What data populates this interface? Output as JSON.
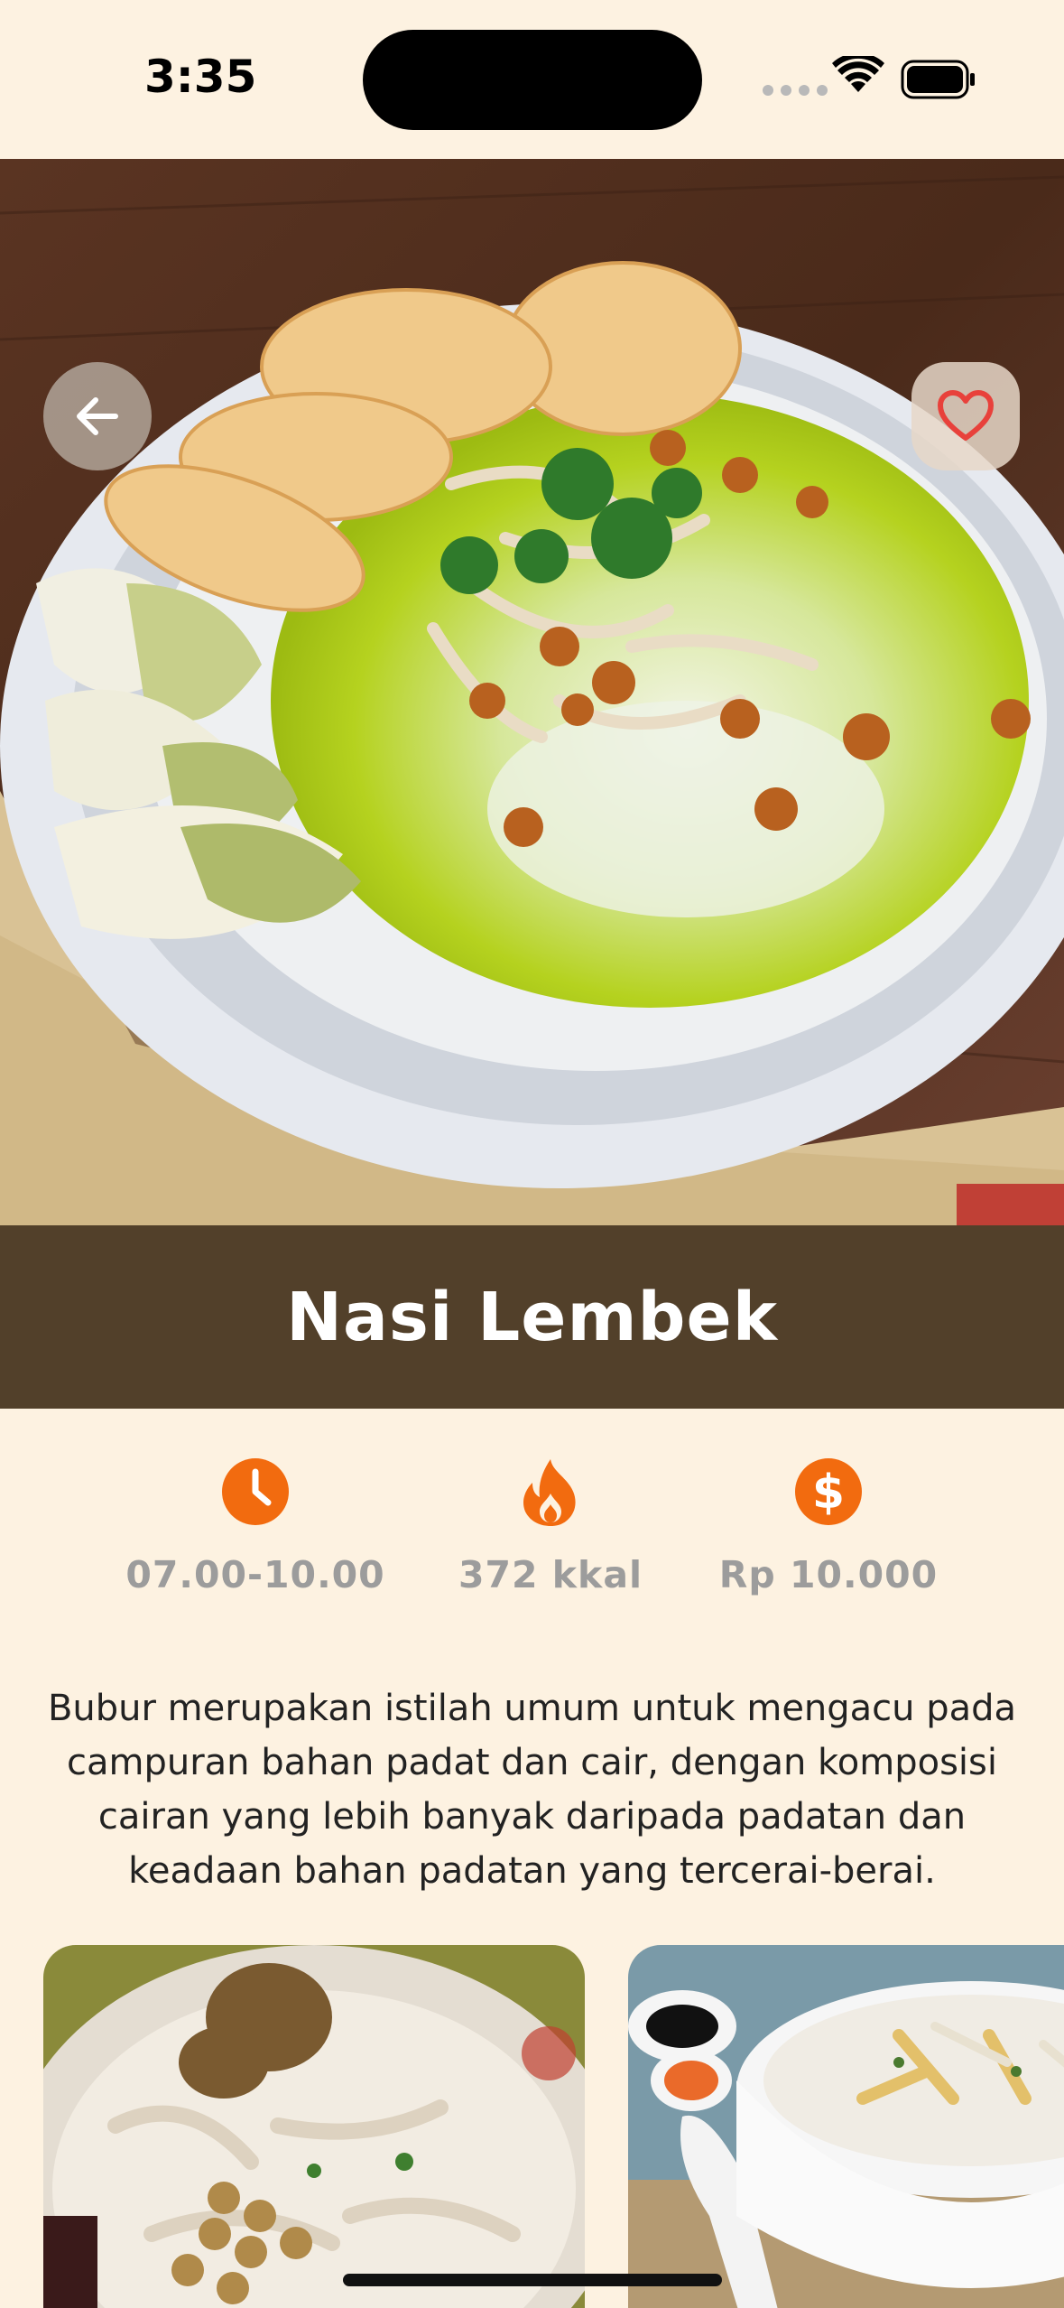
{
  "status_bar": {
    "time": "3:35"
  },
  "hero": {
    "image_description": "bowl of rice porridge with yellow curry sauce, crackers, chicken, fried soybeans and egg",
    "back_icon": "arrow-left-icon",
    "favorite_icon": "heart-outline-icon"
  },
  "dish": {
    "title": "Nasi Lembek"
  },
  "info": {
    "time": "07.00-10.00",
    "calories": "372 kkal",
    "price": "Rp 10.000",
    "icons": [
      "clock-icon",
      "flame-icon",
      "dollar-icon"
    ],
    "icon_color": "#F26B0F"
  },
  "description": "Bubur merupakan istilah umum untuk mengacu pada campuran bahan padat dan cair, dengan komposisi cairan yang lebih banyak daripada padatan dan keadaan bahan padatan yang tercerai-berai.",
  "colors": {
    "background": "#FDF2E1",
    "title_band": "#52402A",
    "favorite_heart": "#E8413B"
  }
}
